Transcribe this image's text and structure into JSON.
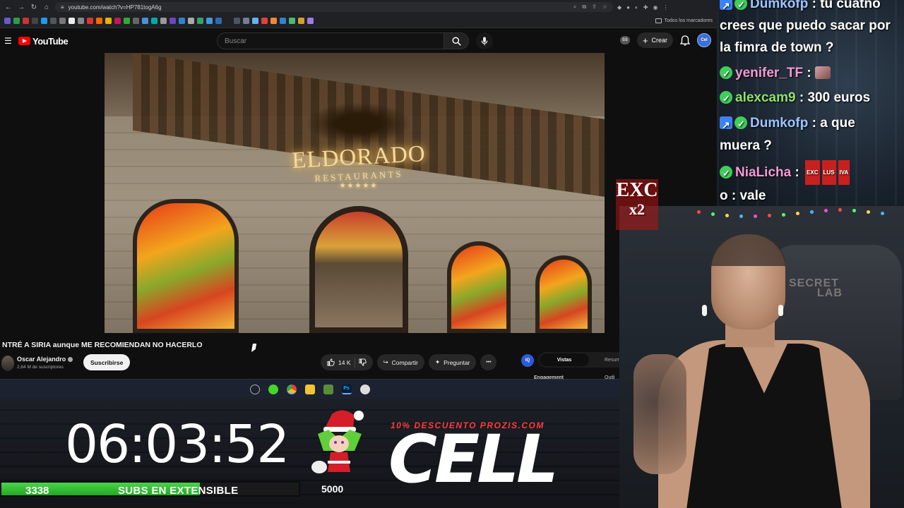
{
  "browser": {
    "url": "youtube.com/watch?v=HP781togA6g",
    "bookmarks_folder": "Todos los marcadores"
  },
  "youtube": {
    "logo_text": "YouTube",
    "search_placeholder": "Buscar",
    "ss_badge": "SS",
    "create_label": "Crear",
    "avatar_text": "Cel",
    "video": {
      "sign_brand": "ELDORADO",
      "sign_sub": "RESTAURANTS",
      "sign_stars": "★★★★★",
      "title": "NTRÉ A SIRIA aunque ME RECOMIENDAN NO HACERLO"
    },
    "channel": {
      "name": "Oscar Alejandro",
      "subscribers": "2,64 M de suscriptores",
      "subscribe_label": "Suscribirse"
    },
    "actions": {
      "likes": "14 K",
      "share": "Compartir",
      "ask": "Preguntar",
      "more": "•••"
    },
    "analytics": {
      "logo": "IQ",
      "tab_active": "Vistas",
      "tab_other": "Resum",
      "label_1": "Engagement",
      "label_2": "Outli"
    }
  },
  "taskbar": {
    "icons": [
      "app-icon",
      "razer-icon",
      "chrome-icon",
      "folder-icon",
      "minecraft-icon",
      "photoshop-icon",
      "obs-icon"
    ],
    "photoshop_label": "Ps"
  },
  "overlay": {
    "timer": "06:03:52",
    "subs_count": "3338",
    "subs_label": "SUBS EN EXTENSIBLE",
    "subs_goal": "5000",
    "subs_progress": 0.6676,
    "promo": "10% DESCUENTO PROZIS.COM",
    "brand": "CELL",
    "colors": {
      "progress": "#3ecf3e",
      "promo": "#ff3c3c"
    }
  },
  "chat": {
    "messages": [
      {
        "user": "Dumkofp",
        "text": ": tu cuatno"
      },
      {
        "user": "",
        "text": "crees que puedo sacar por"
      },
      {
        "user": "",
        "text": "la fimra de town ?"
      },
      {
        "user": "yenifer_TF",
        "text": ":"
      },
      {
        "user": "alexcam9",
        "text": ": 300 euros"
      },
      {
        "user": "Dumkofp",
        "text": ": a que"
      },
      {
        "user": "",
        "text": "muera ?"
      },
      {
        "user": "NiaLicha",
        "text": ":"
      },
      {
        "user": "",
        "text": "o : vale"
      }
    ],
    "nia_emotes": [
      "EXC",
      "LUS",
      "IVA"
    ]
  },
  "webcam": {
    "chair_logo_line1": "SECRET",
    "chair_logo_line2": "LAB"
  },
  "exc_badge": {
    "top": "EXC",
    "bottom": "x2"
  }
}
